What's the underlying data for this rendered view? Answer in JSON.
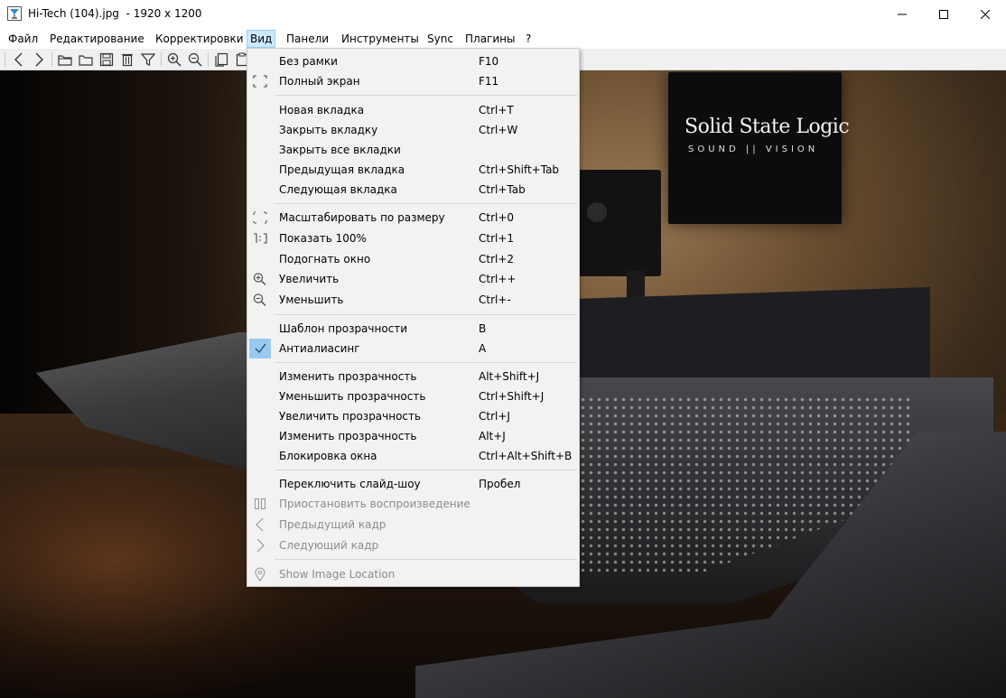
{
  "window": {
    "title": "Hi-Tech (104).jpg  - 1920 x 1200",
    "app_icon": "honeyview-cocktail-icon",
    "controls": [
      "minimize",
      "maximize",
      "close"
    ]
  },
  "menubar": [
    {
      "label": "Файл"
    },
    {
      "label": "Редактирование"
    },
    {
      "label": "Корректировки"
    },
    {
      "label": "Вид",
      "active": true
    },
    {
      "label": "Панели"
    },
    {
      "label": "Инструменты"
    },
    {
      "label": "Sync"
    },
    {
      "label": "Плагины"
    },
    {
      "label": "?"
    }
  ],
  "toolbar": {
    "icons": [
      "back-icon",
      "forward-icon",
      "open-file-icon",
      "open-folder-icon",
      "save-icon",
      "delete-icon",
      "filter-icon",
      "zoom-in-icon",
      "zoom-out-icon",
      "copy-icon",
      "paste-icon"
    ]
  },
  "image": {
    "sign_title": "Solid State Logic",
    "sign_subtitle": "SOUND || VISION"
  },
  "view_menu": {
    "items": [
      {
        "label": "Без рамки",
        "shortcut": "F10",
        "icon": ""
      },
      {
        "label": "Полный экран",
        "shortcut": "F11",
        "icon": "fullscreen-icon"
      },
      {
        "label": "Новая вкладка",
        "shortcut": "Ctrl+T",
        "icon": ""
      },
      {
        "label": "Закрыть вкладку",
        "shortcut": "Ctrl+W",
        "icon": ""
      },
      {
        "label": "Закрыть все вкладки",
        "shortcut": "",
        "icon": ""
      },
      {
        "label": "Предыдущая вкладка",
        "shortcut": "Ctrl+Shift+Tab",
        "icon": ""
      },
      {
        "label": "Следующая вкладка",
        "shortcut": "Ctrl+Tab",
        "icon": ""
      },
      {
        "label": "Масштабировать по размеру",
        "shortcut": "Ctrl+0",
        "icon": "fit-icon"
      },
      {
        "label": "Показать 100%",
        "shortcut": "Ctrl+1",
        "icon": "actual-size-icon"
      },
      {
        "label": "Подогнать окно",
        "shortcut": "Ctrl+2",
        "icon": ""
      },
      {
        "label": "Увеличить",
        "shortcut": "Ctrl++",
        "icon": "zoom-in-icon"
      },
      {
        "label": "Уменьшить",
        "shortcut": "Ctrl+-",
        "icon": "zoom-out-icon"
      },
      {
        "label": "Шаблон прозрачности",
        "shortcut": "B",
        "icon": ""
      },
      {
        "label": "Антиалиасинг",
        "shortcut": "A",
        "icon": "checkmark-icon",
        "checked": true
      },
      {
        "label": "Изменить прозрачность",
        "shortcut": "Alt+Shift+J",
        "icon": ""
      },
      {
        "label": "Уменьшить прозрачность",
        "shortcut": "Ctrl+Shift+J",
        "icon": ""
      },
      {
        "label": "Увеличить прозрачность",
        "shortcut": "Ctrl+J",
        "icon": ""
      },
      {
        "label": "Изменить прозрачность",
        "shortcut": "Alt+J",
        "icon": ""
      },
      {
        "label": "Блокировка окна",
        "shortcut": "Ctrl+Alt+Shift+B",
        "icon": ""
      },
      {
        "label": "Переключить слайд-шоу",
        "shortcut": "Пробел",
        "icon": ""
      },
      {
        "label": "Приостановить воспроизведение",
        "shortcut": "",
        "icon": "pause-icon",
        "disabled": true
      },
      {
        "label": "Предыдущий кадр",
        "shortcut": "",
        "icon": "chevron-left-icon",
        "disabled": true
      },
      {
        "label": "Следующий кадр",
        "shortcut": "",
        "icon": "chevron-right-icon",
        "disabled": true
      },
      {
        "label": "Show Image Location",
        "shortcut": "",
        "icon": "location-pin-icon",
        "disabled": true
      }
    ]
  },
  "colors": {
    "menu_active_bg": "#cce8ff",
    "menu_active_border": "#99d1ff",
    "dropdown_bg": "#f2f2f2",
    "check_bg": "#99c9ef",
    "disabled_text": "#8c8c8c"
  }
}
